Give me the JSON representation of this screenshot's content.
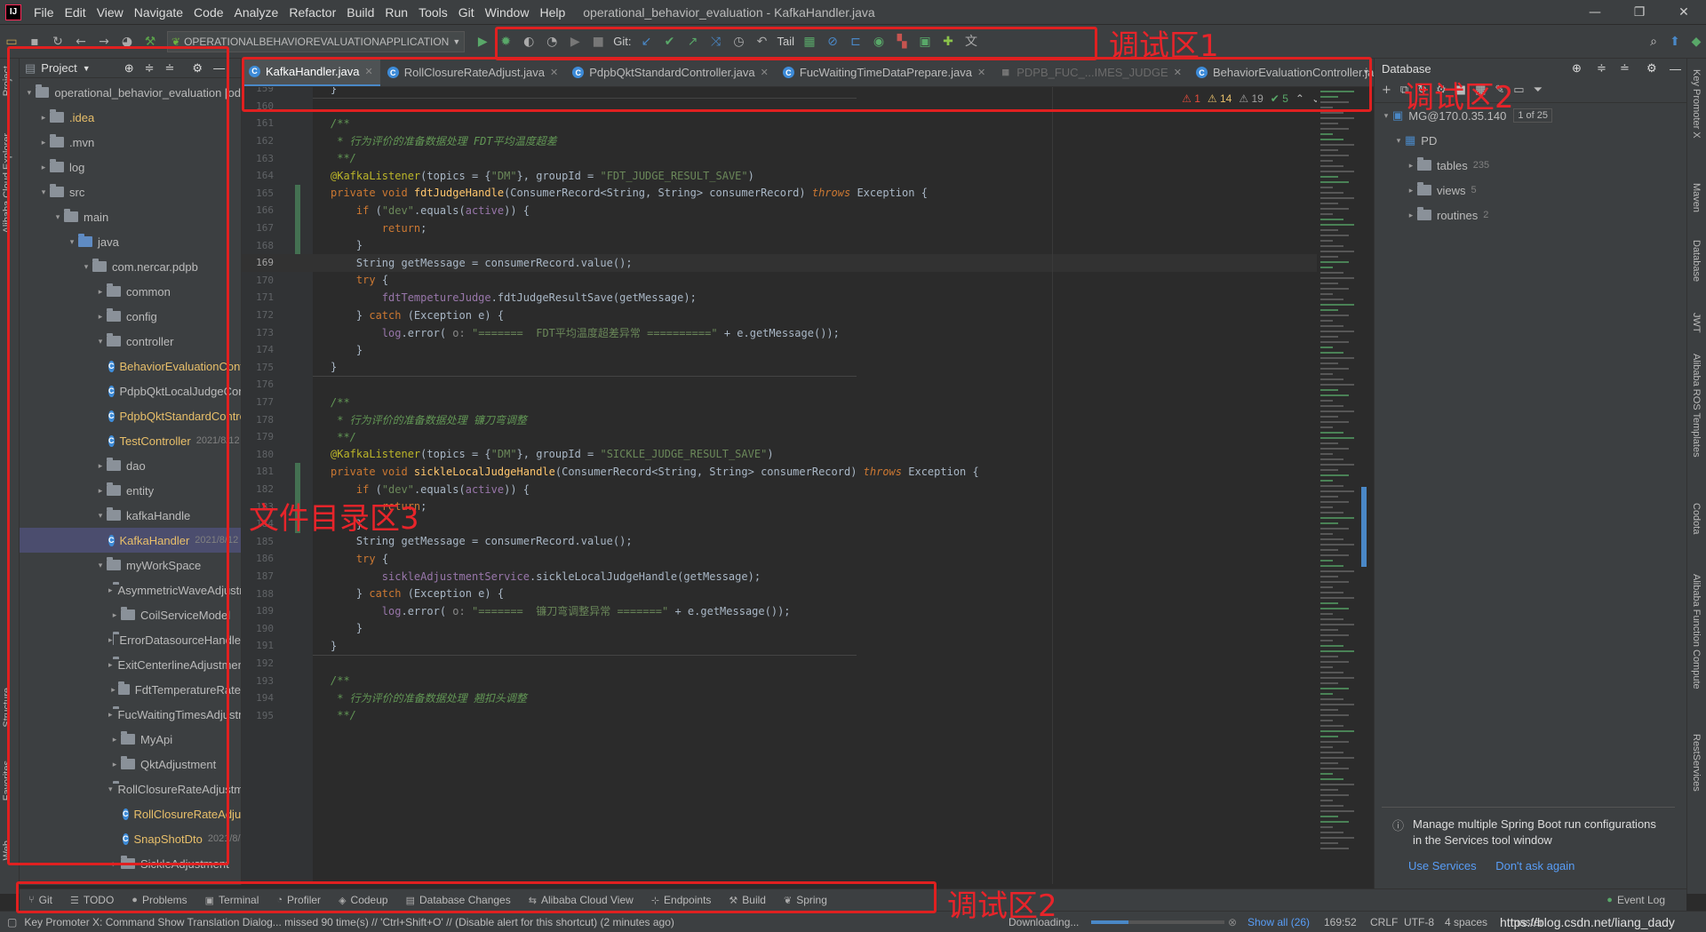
{
  "menu": [
    "File",
    "Edit",
    "View",
    "Navigate",
    "Code",
    "Analyze",
    "Refactor",
    "Build",
    "Run",
    "Tools",
    "Git",
    "Window",
    "Help"
  ],
  "window_title": "operational_behavior_evaluation - KafkaHandler.java",
  "run_config": "OPERATIONALBEHAVIOREVALUATIONAPPLICATION",
  "toolbar": {
    "git_label": "Git:",
    "tail_label": "Tail"
  },
  "project": {
    "title": "Project",
    "tree": [
      {
        "indent": 0,
        "arrow": "▾",
        "icon": "folder",
        "label": "operational_behavior_evaluation [od",
        "style": "normal"
      },
      {
        "indent": 1,
        "arrow": "▸",
        "icon": "folder",
        "label": ".idea",
        "style": "orange"
      },
      {
        "indent": 1,
        "arrow": "▸",
        "icon": "folder",
        "label": ".mvn",
        "style": "normal"
      },
      {
        "indent": 1,
        "arrow": "▸",
        "icon": "folder",
        "label": "log",
        "style": "normal"
      },
      {
        "indent": 1,
        "arrow": "▾",
        "icon": "folder",
        "label": "src",
        "style": "normal"
      },
      {
        "indent": 2,
        "arrow": "▾",
        "icon": "folder",
        "label": "main",
        "style": "normal"
      },
      {
        "indent": 3,
        "arrow": "▾",
        "icon": "folder-blue",
        "label": "java",
        "style": "normal"
      },
      {
        "indent": 4,
        "arrow": "▾",
        "icon": "folder",
        "label": "com.nercar.pdpb",
        "style": "normal"
      },
      {
        "indent": 5,
        "arrow": "▸",
        "icon": "folder",
        "label": "common",
        "style": "normal"
      },
      {
        "indent": 5,
        "arrow": "▸",
        "icon": "folder",
        "label": "config",
        "style": "normal"
      },
      {
        "indent": 5,
        "arrow": "▾",
        "icon": "folder",
        "label": "controller",
        "style": "normal"
      },
      {
        "indent": 6,
        "arrow": "",
        "icon": "class",
        "label": "BehaviorEvaluationContro",
        "style": "orange"
      },
      {
        "indent": 6,
        "arrow": "",
        "icon": "class",
        "label": "PdpbQktLocalJudgeContr",
        "style": "normal"
      },
      {
        "indent": 6,
        "arrow": "",
        "icon": "class",
        "label": "PdpbQktStandardControll",
        "style": "orange"
      },
      {
        "indent": 6,
        "arrow": "",
        "icon": "class",
        "label": "TestController",
        "style": "orange",
        "meta": "2021/8/12 1"
      },
      {
        "indent": 5,
        "arrow": "▸",
        "icon": "folder",
        "label": "dao",
        "style": "normal"
      },
      {
        "indent": 5,
        "arrow": "▸",
        "icon": "folder",
        "label": "entity",
        "style": "normal"
      },
      {
        "indent": 5,
        "arrow": "▾",
        "icon": "folder",
        "label": "kafkaHandle",
        "style": "normal"
      },
      {
        "indent": 6,
        "arrow": "",
        "icon": "class",
        "label": "KafkaHandler",
        "style": "selected",
        "meta": "2021/8/12 1"
      },
      {
        "indent": 5,
        "arrow": "▾",
        "icon": "folder",
        "label": "myWorkSpace",
        "style": "normal"
      },
      {
        "indent": 6,
        "arrow": "▸",
        "icon": "folder",
        "label": "AsymmetricWaveAdjustment",
        "style": "normal"
      },
      {
        "indent": 6,
        "arrow": "▸",
        "icon": "folder",
        "label": "CoilServiceModel",
        "style": "normal"
      },
      {
        "indent": 6,
        "arrow": "▸",
        "icon": "folder",
        "label": "ErrorDatasourceHandle",
        "style": "normal"
      },
      {
        "indent": 6,
        "arrow": "▸",
        "icon": "folder",
        "label": "ExitCenterlineAdjustment",
        "style": "normal"
      },
      {
        "indent": 6,
        "arrow": "▸",
        "icon": "folder",
        "label": "FdtTemperatureRate",
        "style": "normal"
      },
      {
        "indent": 6,
        "arrow": "▸",
        "icon": "folder",
        "label": "FucWaitingTimesAdjustment",
        "style": "normal"
      },
      {
        "indent": 6,
        "arrow": "▸",
        "icon": "folder",
        "label": "MyApi",
        "style": "normal"
      },
      {
        "indent": 6,
        "arrow": "▸",
        "icon": "folder",
        "label": "QktAdjustment",
        "style": "normal"
      },
      {
        "indent": 6,
        "arrow": "▾",
        "icon": "folder",
        "label": "RollClosureRateAdjustment",
        "style": "normal"
      },
      {
        "indent": 7,
        "arrow": "",
        "icon": "class",
        "label": "RollClosureRateAdjus",
        "style": "orange"
      },
      {
        "indent": 7,
        "arrow": "",
        "icon": "class",
        "label": "SnapShotDto",
        "style": "orange",
        "meta": "2021/8/2"
      },
      {
        "indent": 6,
        "arrow": "▸",
        "icon": "folder",
        "label": "SickleAdjustment",
        "style": "normal"
      }
    ]
  },
  "tabs": [
    {
      "label": "KafkaHandler.java",
      "active": true,
      "dim": false
    },
    {
      "label": "RollClosureRateAdjust.java",
      "active": false,
      "dim": false
    },
    {
      "label": "PdpbQktStandardController.java",
      "active": false,
      "dim": false
    },
    {
      "label": "FucWaitingTimeDataPrepare.java",
      "active": false,
      "dim": false
    },
    {
      "label": "PDPB_FUC_...IMES_JUDGE",
      "active": false,
      "dim": true
    },
    {
      "label": "BehaviorEvaluationController.ja",
      "active": false,
      "dim": false
    }
  ],
  "inspections": {
    "warn1": "1",
    "warn2": "14",
    "warn3": "19",
    "ok": "5"
  },
  "code": [
    {
      "n": "159",
      "html": "<span>}</span>",
      "cur": false
    },
    {
      "n": "160",
      "html": "",
      "cur": false
    },
    {
      "n": "161",
      "html": "<span class='cmt'>/**</span>",
      "cur": false
    },
    {
      "n": "162",
      "html": "<span class='cmt'> * 行为评价的准备数据处理 FDT平均温度超差</span>",
      "cur": false
    },
    {
      "n": "163",
      "html": "<span class='cmt'> **/</span>",
      "cur": false
    },
    {
      "n": "164",
      "html": "<span class='ann'>@KafkaListener</span>(topics = {<span class='str'>\"DM\"</span>}, groupId = <span class='str'>\"FDT_JUDGE_RESULT_SAVE\"</span>)",
      "cur": false
    },
    {
      "n": "165",
      "html": "<span class='kw'>private void </span><span class='fn'>fdtJudgeHandle</span>(ConsumerRecord&lt;String, String&gt; consumerRecord) <span class='kwi'>throws</span> Exception {",
      "cur": false
    },
    {
      "n": "166",
      "html": "    <span class='kw'>if</span> (<span class='str'>\"dev\"</span>.equals(<span class='fld'>active</span>)) {",
      "cur": false
    },
    {
      "n": "167",
      "html": "        <span class='kw'>return</span>;",
      "cur": false
    },
    {
      "n": "168",
      "html": "    }",
      "cur": false
    },
    {
      "n": "169",
      "html": "    String getMessage = consumerRecord.value();",
      "cur": true
    },
    {
      "n": "170",
      "html": "    <span class='kw'>try</span> {",
      "cur": false
    },
    {
      "n": "171",
      "html": "        <span class='fld'>fdtTempetureJudge</span>.fdtJudgeResultSave(getMessage);",
      "cur": false
    },
    {
      "n": "172",
      "html": "    } <span class='kw'>catch</span> (Exception e) {",
      "cur": false
    },
    {
      "n": "173",
      "html": "        <span class='fld'>log</span>.error( <span class='prm'>o:</span> <span class='str'>\"=======  FDT平均温度超差异常 ==========\"</span> + e.getMessage());",
      "cur": false
    },
    {
      "n": "174",
      "html": "    }",
      "cur": false
    },
    {
      "n": "175",
      "html": "}",
      "cur": false
    },
    {
      "n": "176",
      "html": "",
      "cur": false
    },
    {
      "n": "177",
      "html": "<span class='cmt'>/**</span>",
      "cur": false
    },
    {
      "n": "178",
      "html": "<span class='cmt'> * 行为评价的准备数据处理 镰刀弯调整</span>",
      "cur": false
    },
    {
      "n": "179",
      "html": "<span class='cmt'> **/</span>",
      "cur": false
    },
    {
      "n": "180",
      "html": "<span class='ann'>@KafkaListener</span>(topics = {<span class='str'>\"DM\"</span>}, groupId = <span class='str'>\"SICKLE_JUDGE_RESULT_SAVE\"</span>)",
      "cur": false
    },
    {
      "n": "181",
      "html": "<span class='kw'>private void </span><span class='fn'>sickleLocalJudgeHandle</span>(ConsumerRecord&lt;String, String&gt; consumerRecord) <span class='kwi'>throws</span> Exception {",
      "cur": false
    },
    {
      "n": "182",
      "html": "    <span class='kw'>if</span> (<span class='str'>\"dev\"</span>.equals(<span class='fld'>active</span>)) {",
      "cur": false
    },
    {
      "n": "183",
      "html": "        <span class='kw'>return</span>;",
      "cur": false
    },
    {
      "n": "184",
      "html": "    }",
      "cur": false
    },
    {
      "n": "185",
      "html": "    String getMessage = consumerRecord.value();",
      "cur": false
    },
    {
      "n": "186",
      "html": "    <span class='kw'>try</span> {",
      "cur": false
    },
    {
      "n": "187",
      "html": "        <span class='fld'>sickleAdjustmentService</span>.sickleLocalJudgeHandle(getMessage);",
      "cur": false
    },
    {
      "n": "188",
      "html": "    } <span class='kw'>catch</span> (Exception e) {",
      "cur": false
    },
    {
      "n": "189",
      "html": "        <span class='fld'>log</span>.error( <span class='prm'>o:</span> <span class='str'>\"=======  镰刀弯调整异常 =======\"</span> + e.getMessage());",
      "cur": false
    },
    {
      "n": "190",
      "html": "    }",
      "cur": false
    },
    {
      "n": "191",
      "html": "}",
      "cur": false
    },
    {
      "n": "192",
      "html": "",
      "cur": false
    },
    {
      "n": "193",
      "html": "<span class='cmt'>/**</span>",
      "cur": false
    },
    {
      "n": "194",
      "html": "<span class='cmt'> * 行为评价的准备数据处理 翘扣头调整</span>",
      "cur": false
    },
    {
      "n": "195",
      "html": "<span class='cmt'> **/</span>",
      "cur": false
    }
  ],
  "database": {
    "title": "Database",
    "connection": "MG@170.0.35.140",
    "page": "1 of 25",
    "schema": "PD",
    "items": [
      {
        "label": "tables",
        "count": "235"
      },
      {
        "label": "views",
        "count": "5"
      },
      {
        "label": "routines",
        "count": "2"
      }
    ],
    "notification": {
      "text": "Manage multiple Spring Boot run configurations in the Services tool window",
      "action1": "Use Services",
      "action2": "Don't ask again"
    }
  },
  "left_strip": [
    "Project",
    "Alibaba Cloud Explorer",
    "Structure",
    "Favorites",
    "Web"
  ],
  "right_strip": [
    "Key Promoter X",
    "Maven",
    "Database",
    "JWT",
    "Alibaba ROS Templates",
    "Codota",
    "Alibaba Function Compute",
    "RestServices"
  ],
  "bottom_tools": [
    {
      "icon": "⑂",
      "label": "Git"
    },
    {
      "icon": "☰",
      "label": "TODO"
    },
    {
      "icon": "●",
      "label": "Problems"
    },
    {
      "icon": "▣",
      "label": "Terminal"
    },
    {
      "icon": "◔",
      "label": "Profiler"
    },
    {
      "icon": "◈",
      "label": "Codeup"
    },
    {
      "icon": "▤",
      "label": "Database Changes"
    },
    {
      "icon": "⇆",
      "label": "Alibaba Cloud View"
    },
    {
      "icon": "⊹",
      "label": "Endpoints"
    },
    {
      "icon": "⚒",
      "label": "Build"
    },
    {
      "icon": "❦",
      "label": "Spring"
    }
  ],
  "event_log": "Event Log",
  "status": {
    "message": "Key Promoter X: Command Show Translation Dialog... missed 90 time(s) // 'Ctrl+Shift+O' // (Disable alert for this shortcut) (2 minutes ago)",
    "downloading": "Downloading...",
    "show_all": "Show all (26)",
    "position": "169:52",
    "line_ending": "CRLF",
    "encoding": "UTF-8",
    "indent": "4 spaces",
    "branch": "master",
    "watermark": "https://blog.csdn.net/liang_dady"
  },
  "annotations": {
    "debug1": "调试区1",
    "debug2_top": "调试区2",
    "debug2_bottom": "调试区2",
    "filedir": "文件目录区3"
  }
}
